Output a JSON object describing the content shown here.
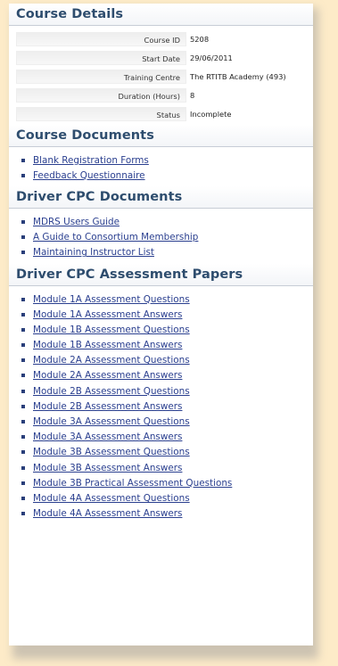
{
  "course_details": {
    "title": "Course Details",
    "rows": [
      {
        "label": "Course ID",
        "value": "5208"
      },
      {
        "label": "Start Date",
        "value": "29/06/2011"
      },
      {
        "label": "Training Centre",
        "value": "The RTITB Academy (493)"
      },
      {
        "label": "Duration (Hours)",
        "value": "8"
      },
      {
        "label": "Status",
        "value": "Incomplete"
      }
    ]
  },
  "course_documents": {
    "title": "Course Documents",
    "links": [
      "Blank Registration Forms",
      "Feedback Questionnaire"
    ]
  },
  "driver_cpc_documents": {
    "title": "Driver CPC Documents",
    "links": [
      "MDRS Users Guide",
      "A Guide to Consortium Membership",
      "Maintaining Instructor List"
    ]
  },
  "assessment_papers": {
    "title": "Driver CPC Assessment Papers",
    "links": [
      "Module 1A Assessment Questions",
      "Module 1A Assessment Answers",
      "Module 1B Assessment Questions",
      "Module 1B Assessment Answers",
      "Module 2A Assessment Questions",
      "Module 2A Assessment Answers",
      "Module 2B Assessment Questions",
      "Module 2B Assessment Answers",
      "Module 3A Assessment Questions",
      "Module 3A Assessment Answers",
      "Module 3B Assessment Questions",
      "Module 3B Assessment Answers",
      "Module 3B Practical Assessment Questions",
      "Module 4A Assessment Questions",
      "Module 4A Assessment Answers"
    ]
  }
}
